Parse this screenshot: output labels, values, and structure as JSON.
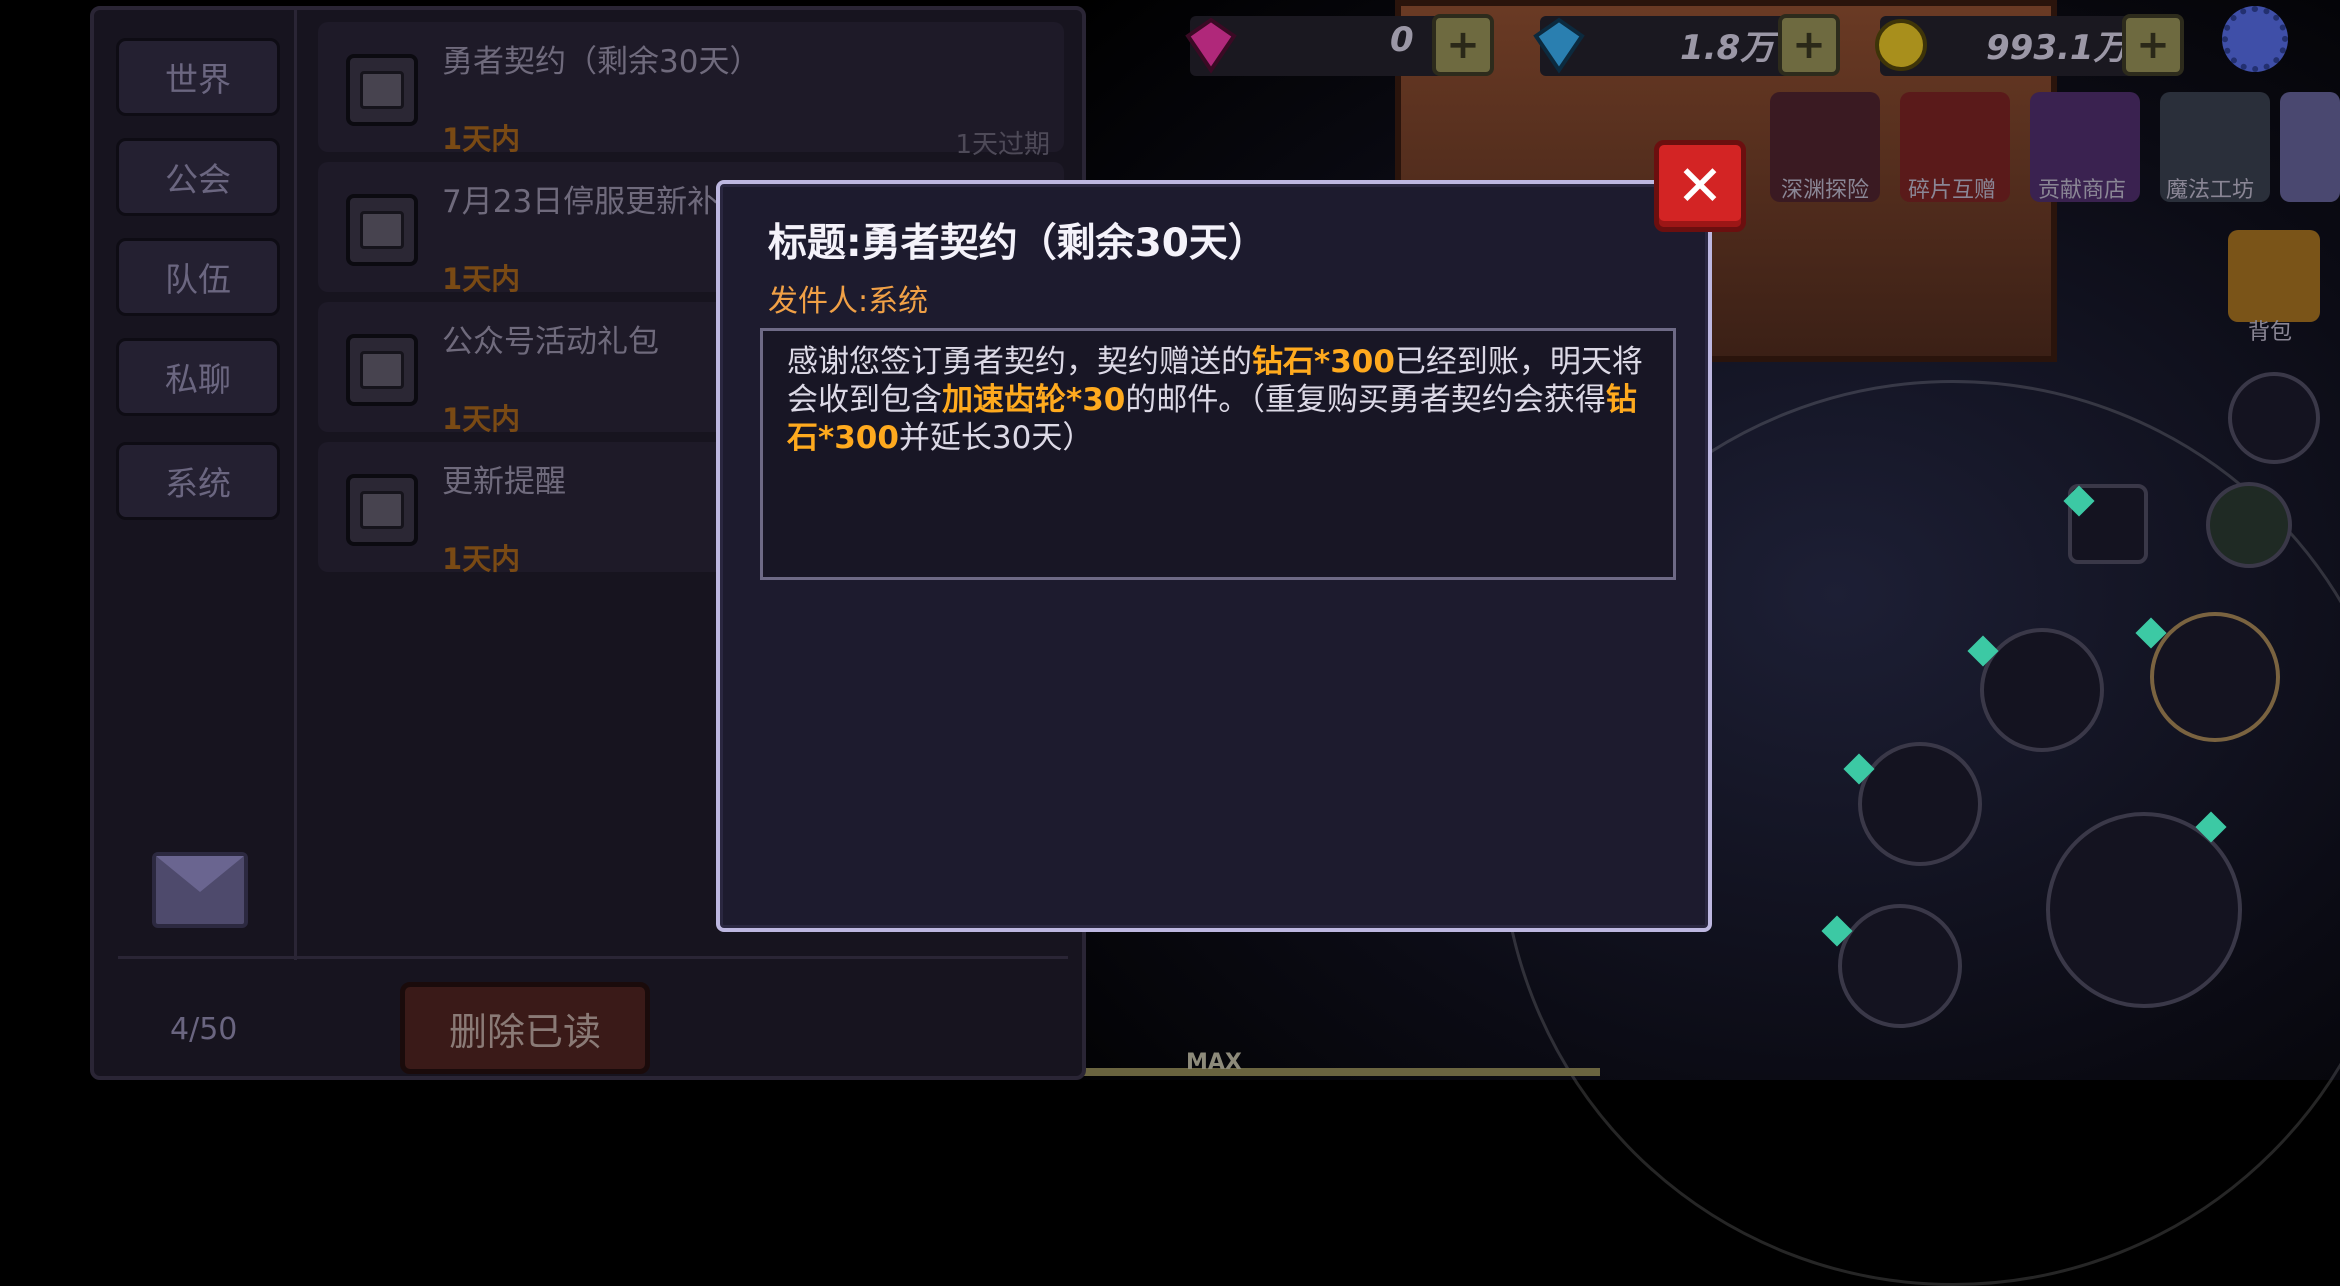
{
  "hud": {
    "gems_value": "0",
    "diamonds_value": "1.8万",
    "gold_value": "993.1万",
    "plus_label": "+"
  },
  "shop_buttons": [
    {
      "label": "深渊探险"
    },
    {
      "label": "碎片互赠"
    },
    {
      "label": "贡献商店"
    },
    {
      "label": "魔法工坊"
    }
  ],
  "bag_label": "背包",
  "side_tabs": [
    {
      "label": "世界"
    },
    {
      "label": "公会"
    },
    {
      "label": "队伍"
    },
    {
      "label": "私聊"
    },
    {
      "label": "系统"
    }
  ],
  "mail_list": [
    {
      "title": "勇者契约（剩余30天）",
      "time": "1天内",
      "expire": "1天过期"
    },
    {
      "title": "7月23日停服更新补偿",
      "time": "1天内",
      "expire": ""
    },
    {
      "title": "公众号活动礼包",
      "time": "1天内",
      "expire": ""
    },
    {
      "title": "更新提醒",
      "time": "1天内",
      "expire": ""
    }
  ],
  "mail_count": "4/50",
  "delete_read_label": "删除已读",
  "dialog": {
    "title": "标题:勇者契约（剩余30天）",
    "sender": "发件人:系统",
    "body_parts": [
      "感谢您签订勇者契约，契约赠送的",
      "钻石*300",
      "已经到账，明天将会收到包含",
      "加速齿轮*30",
      "的邮件。（重复购买勇者契约会获得",
      "钻石*300",
      "并延长30天）"
    ],
    "close_label": "✕"
  },
  "max_label": "MAX",
  "colors": {
    "highlight": "#ffaa1e",
    "sender": "#f0a046",
    "close_red": "#d32424"
  }
}
